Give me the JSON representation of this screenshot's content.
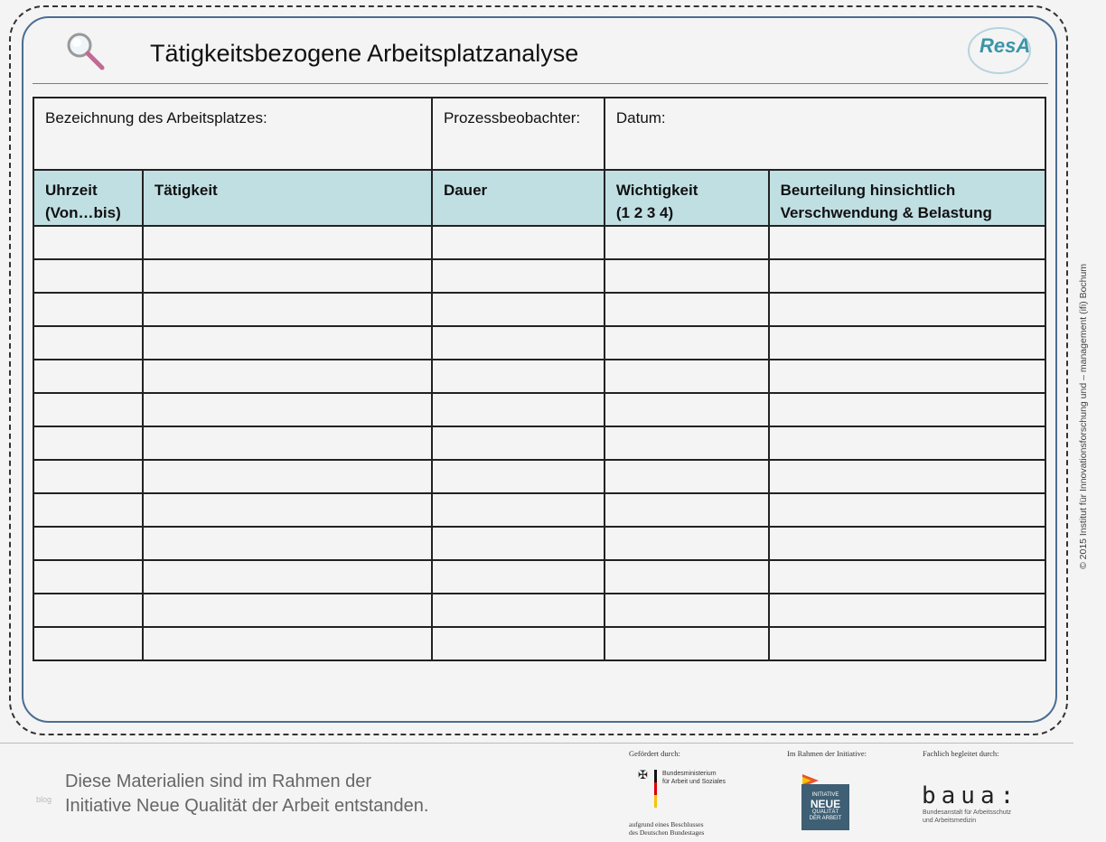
{
  "header": {
    "title": "Tätigkeitsbezogene Arbeitsplatzanalyse",
    "logo_text": "ResA",
    "icons": [
      "magnifier-icon"
    ]
  },
  "form": {
    "top_fields": [
      "Bezeichnung des Arbeitsplatzes:",
      "Prozessbeobachter:",
      "Datum:"
    ],
    "columns": [
      "Uhrzeit\n(Von…bis)",
      "Tätigkeit",
      "Dauer",
      "Wichtigkeit\n(1 2 3 4)",
      "Beurteilung hinsichtlich\nVerschwendung & Belastung"
    ],
    "empty_rows": 13
  },
  "copyright": "© 2015 Institut für Innovationsforschung  und – management (ifi) Bochum",
  "footer": {
    "text": "Diese Materialien sind im Rahmen der\nInitiative Neue Qualität der Arbeit entstanden.",
    "watermark": "blog",
    "funded_label": "Gefördert durch:",
    "ministry": "Bundesministerium\nfür Arbeit und Soziales",
    "ministry_note": "aufgrund eines Beschlusses\ndes Deutschen Bundestages",
    "initiative_label": "Im Rahmen der Initiative:",
    "initiative_logo_top": "INITIATIVE",
    "initiative_logo_big": "NEUE",
    "initiative_logo_bottom": "QUALITÄT\nDER ARBEIT",
    "supervised_label": "Fachlich begleitet durch:",
    "baua_logo": "baua:",
    "baua_sub": "Bundesanstalt für Arbeitsschutz\nund Arbeitsmedizin"
  }
}
